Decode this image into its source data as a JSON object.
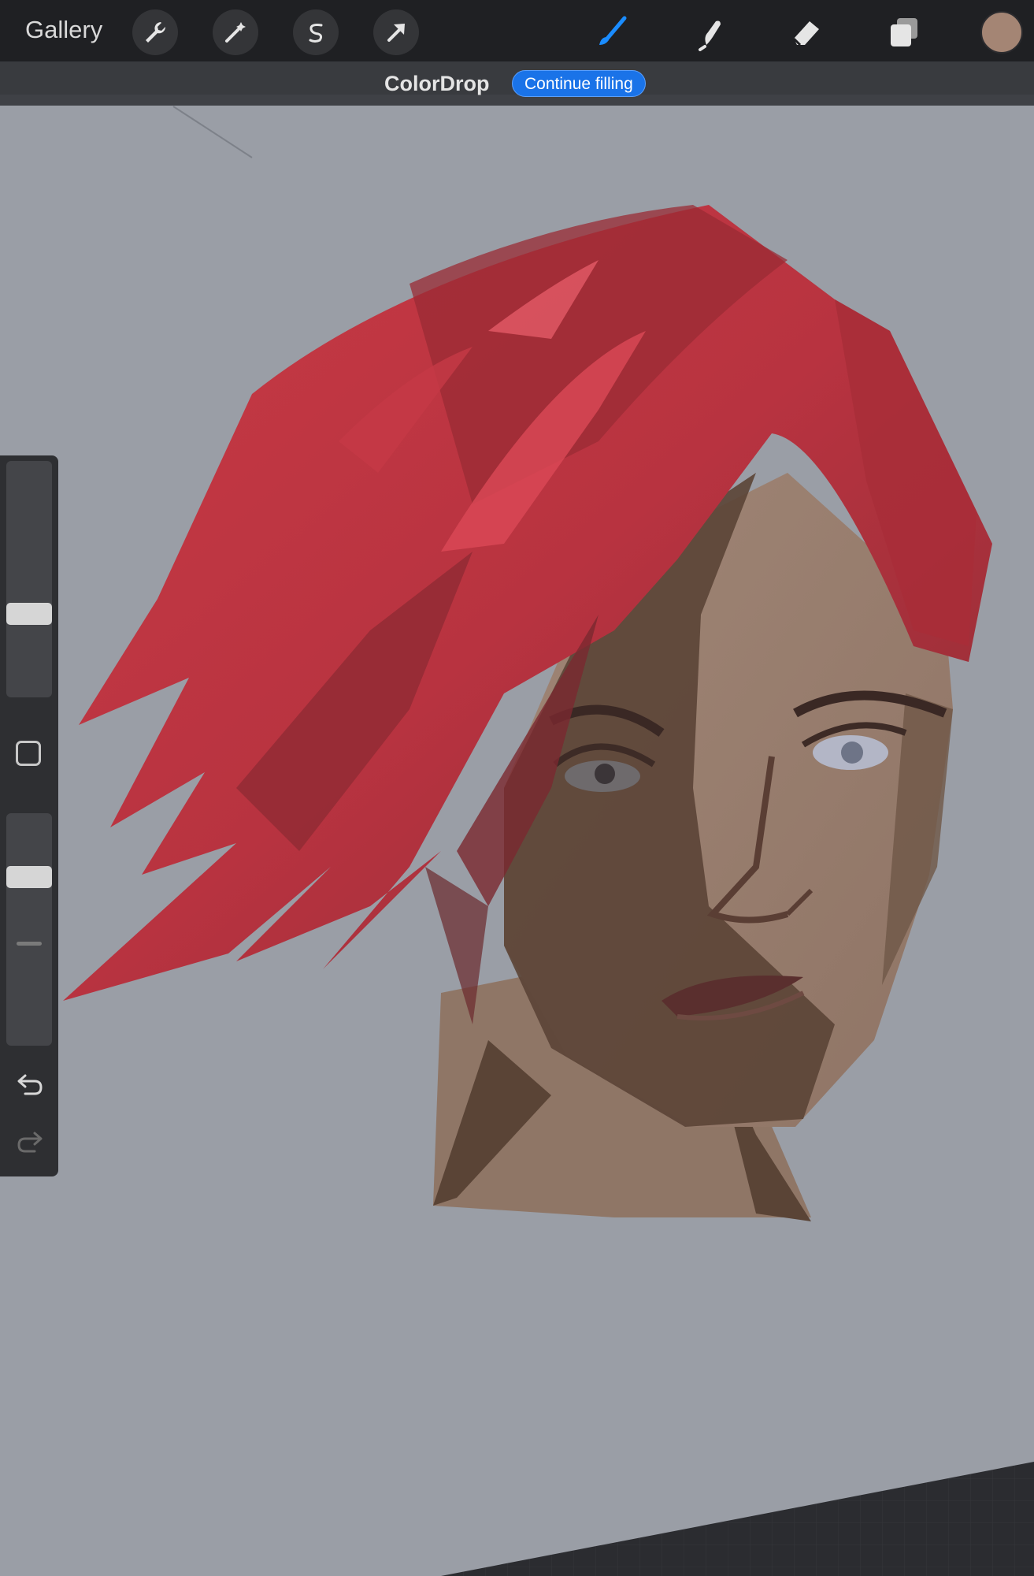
{
  "topbar": {
    "gallery_label": "Gallery",
    "tools_left": [
      "wrench-icon",
      "magic-wand-icon",
      "selection-s-icon",
      "transform-arrow-icon"
    ],
    "tools_right": [
      "brush-icon",
      "smudge-icon",
      "eraser-icon",
      "layers-icon"
    ],
    "active_tool": "brush-icon",
    "accent_color": "#1a8cff",
    "current_color": "#a48574"
  },
  "banner": {
    "title": "ColorDrop",
    "button_label": "Continue filling",
    "button_color": "#1a73e8"
  },
  "sidebar": {
    "brush_size_level": 0.32,
    "opacity_level": 0.3,
    "modifier_icon": "square-icon",
    "undo_icon": "undo-icon",
    "redo_icon": "redo-icon"
  },
  "canvas": {
    "background_color": "#9a9ea6",
    "artwork": "portrait-red-hair"
  }
}
